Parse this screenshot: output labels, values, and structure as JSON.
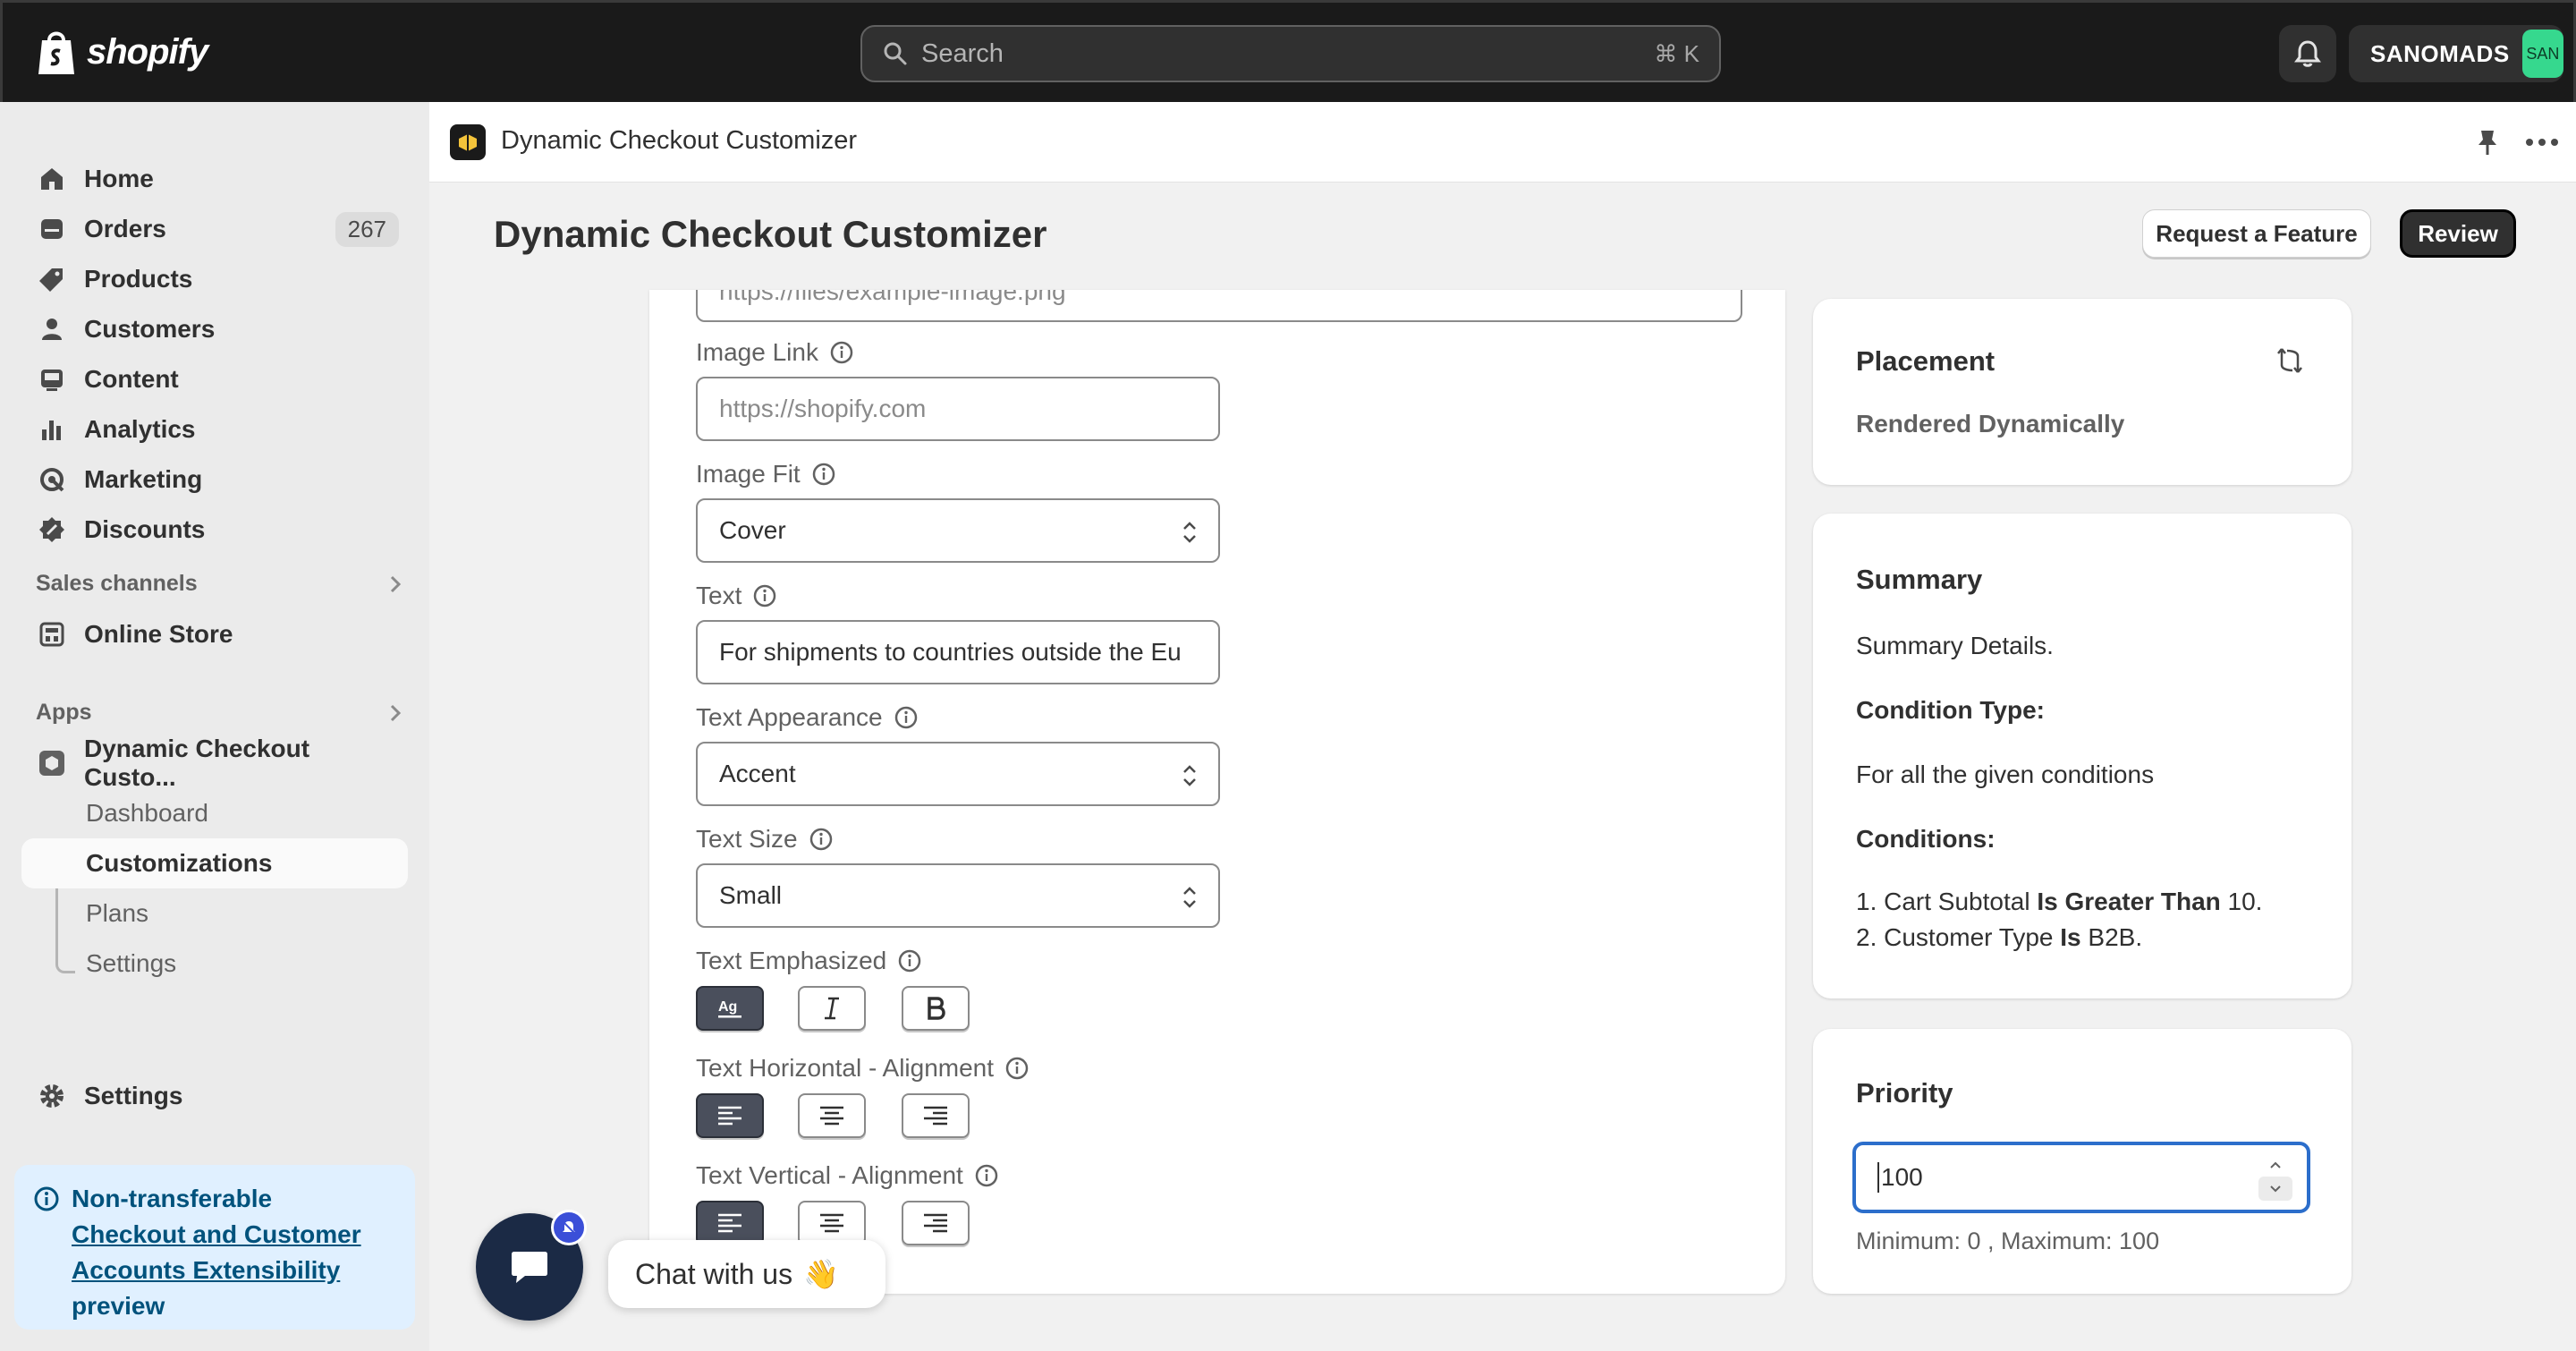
{
  "topbar": {
    "logo_text": "shopify",
    "search_placeholder": "Search",
    "search_shortcut": "⌘ K",
    "store_name": "SANOMADS",
    "store_avatar": "SAN"
  },
  "sidebar": {
    "nav": [
      {
        "label": "Home",
        "icon": "home-icon"
      },
      {
        "label": "Orders",
        "icon": "orders-icon",
        "count": "267"
      },
      {
        "label": "Products",
        "icon": "tag-icon"
      },
      {
        "label": "Customers",
        "icon": "person-icon"
      },
      {
        "label": "Content",
        "icon": "content-icon"
      },
      {
        "label": "Analytics",
        "icon": "analytics-icon"
      },
      {
        "label": "Marketing",
        "icon": "marketing-icon"
      },
      {
        "label": "Discounts",
        "icon": "discount-icon"
      }
    ],
    "sales_channels_heading": "Sales channels",
    "online_store": "Online Store",
    "apps_heading": "Apps",
    "app_name": "Dynamic Checkout Custo...",
    "app_subnav": [
      {
        "label": "Dashboard"
      },
      {
        "label": "Customizations"
      },
      {
        "label": "Plans"
      },
      {
        "label": "Settings"
      }
    ],
    "settings": "Settings",
    "banner": {
      "title": "Non-transferable",
      "link": "Checkout and Customer Accounts Extensibility",
      "suffix": "preview"
    }
  },
  "app_header": {
    "title": "Dynamic Checkout Customizer"
  },
  "page": {
    "title": "Dynamic Checkout Customizer",
    "request_feature": "Request a Feature",
    "review": "Review"
  },
  "form": {
    "image_url_value": "https://files/example-image.png",
    "image_link_label": "Image Link",
    "image_link_placeholder": "https://shopify.com",
    "image_fit_label": "Image Fit",
    "image_fit_value": "Cover",
    "text_label": "Text",
    "text_value": "For shipments to countries outside the Eu",
    "text_appearance_label": "Text Appearance",
    "text_appearance_value": "Accent",
    "text_size_label": "Text Size",
    "text_size_value": "Small",
    "text_emphasized_label": "Text Emphasized",
    "text_h_align_label": "Text Horizontal - Alignment",
    "text_v_align_label": "Text Vertical - Alignment"
  },
  "placement": {
    "title": "Placement",
    "value": "Rendered Dynamically"
  },
  "summary": {
    "title": "Summary",
    "details": "Summary Details.",
    "condition_type_label": "Condition Type:",
    "condition_type_value": "For all the given conditions",
    "conditions_label": "Conditions:",
    "c1_prefix": "1. Cart Subtotal ",
    "c1_op": "Is Greater Than",
    "c1_value": " 10.",
    "c2_prefix": "2. Customer Type ",
    "c2_op": "Is",
    "c2_value": " B2B."
  },
  "priority": {
    "title": "Priority",
    "value": "100",
    "hint": "Minimum: 0 , Maximum: 100"
  },
  "chat": {
    "label": "Chat with us",
    "emoji": "👋"
  },
  "colors": {
    "topbar": "#1a1a1a",
    "sidebar": "#ebebeb",
    "focus": "#2c6ecb",
    "banner": "#e0f0ff",
    "avatar": "#36d88e"
  }
}
